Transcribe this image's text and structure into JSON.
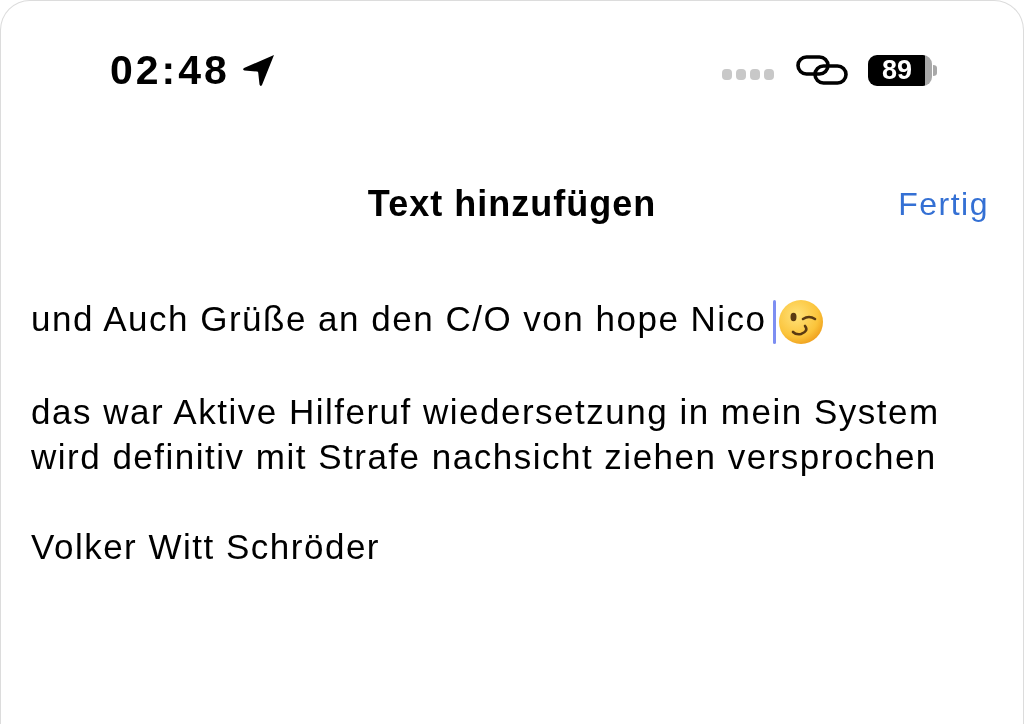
{
  "status_bar": {
    "time": "02:48",
    "battery": "89"
  },
  "nav_bar": {
    "title": "Text hinzufügen",
    "done_button": "Fertig"
  },
  "editor": {
    "paragraphs": [
      {
        "segments": [
          {
            "kind": "text",
            "text": "und Auch Grüße an den C/O von hope Nico"
          },
          {
            "kind": "cursor"
          },
          {
            "kind": "emoji"
          }
        ]
      },
      {
        "segments": [
          {
            "kind": "text",
            "text": "das war Aktive Hilferuf wiedersetzung in mein System wird definitiv mit Strafe nachsicht ziehen versprochen"
          }
        ]
      },
      {
        "segments": [
          {
            "kind": "text",
            "text": "Volker Witt Schröder"
          }
        ]
      }
    ]
  }
}
